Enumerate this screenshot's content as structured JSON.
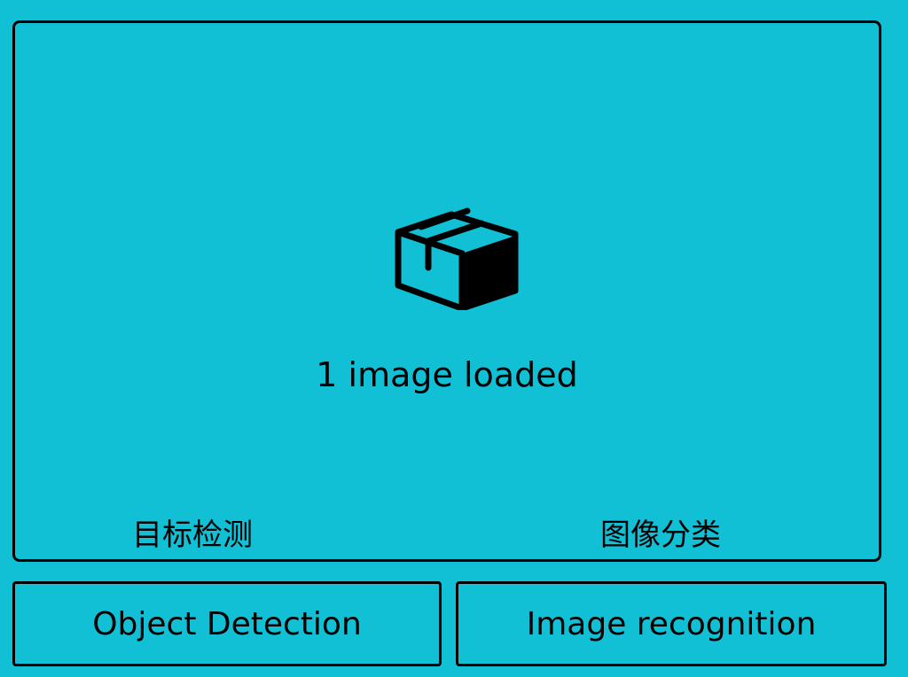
{
  "panel": {
    "icon": "box-icon",
    "status": "1 image loaded",
    "labels": {
      "detection_cn": "目标检测",
      "classification_cn": "图像分类"
    }
  },
  "buttons": {
    "object_detection": "Object Detection",
    "image_recognition": "Image recognition"
  },
  "colors": {
    "background": "#12c0d6",
    "border": "#000000"
  }
}
